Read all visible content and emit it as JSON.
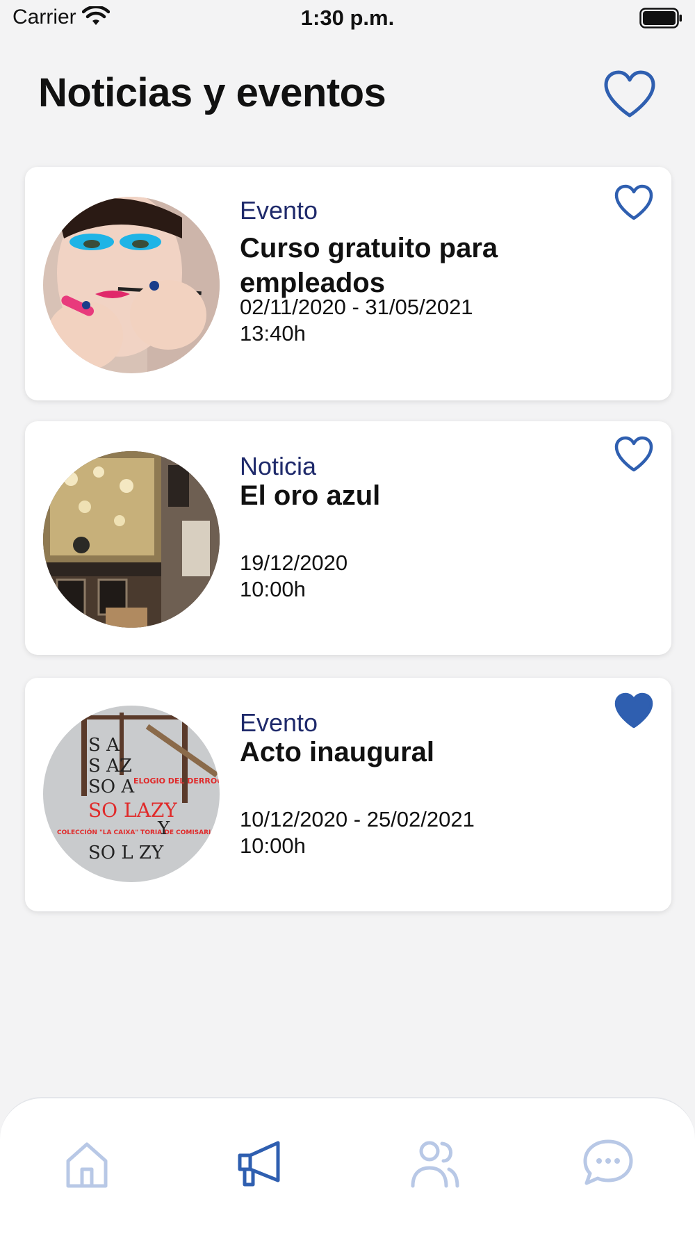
{
  "status_bar": {
    "carrier": "Carrier",
    "time": "1:30 p.m."
  },
  "header": {
    "title": "Noticias y eventos",
    "favorites_icon": "heart-outline-icon"
  },
  "colors": {
    "accent": "#2f5fb0",
    "accent_light": "#b8c8e6",
    "type_label": "#1f2a6b",
    "background": "#f3f3f4"
  },
  "items": [
    {
      "type": "Evento",
      "title": "Curso gratuito para empleados",
      "date": "02/11/2020 - 31/05/2021",
      "time": "13:40h",
      "favorite": false,
      "image": "makeup-photo"
    },
    {
      "type": "Noticia",
      "title": "El oro azul",
      "date": "19/12/2020",
      "time": "10:00h",
      "favorite": false,
      "image": "shop-window-photo"
    },
    {
      "type": "Evento",
      "title": "Acto inaugural",
      "date": "10/12/2020 - 25/02/2021",
      "time": "10:00h",
      "favorite": true,
      "image": "exhibition-poster",
      "poster_text": {
        "title": "SO LAZY",
        "subtitle": "ELOGIO DEL DERROCHE",
        "caption": "COLECCIÓN \"LA CAIXA\" TORIA DE COMISARIADO"
      }
    }
  ],
  "bottom_nav": [
    {
      "name": "home",
      "icon": "home-icon",
      "active": false
    },
    {
      "name": "news",
      "icon": "megaphone-icon",
      "active": true
    },
    {
      "name": "contacts",
      "icon": "users-icon",
      "active": false
    },
    {
      "name": "chat",
      "icon": "chat-bubble-icon",
      "active": false
    }
  ]
}
